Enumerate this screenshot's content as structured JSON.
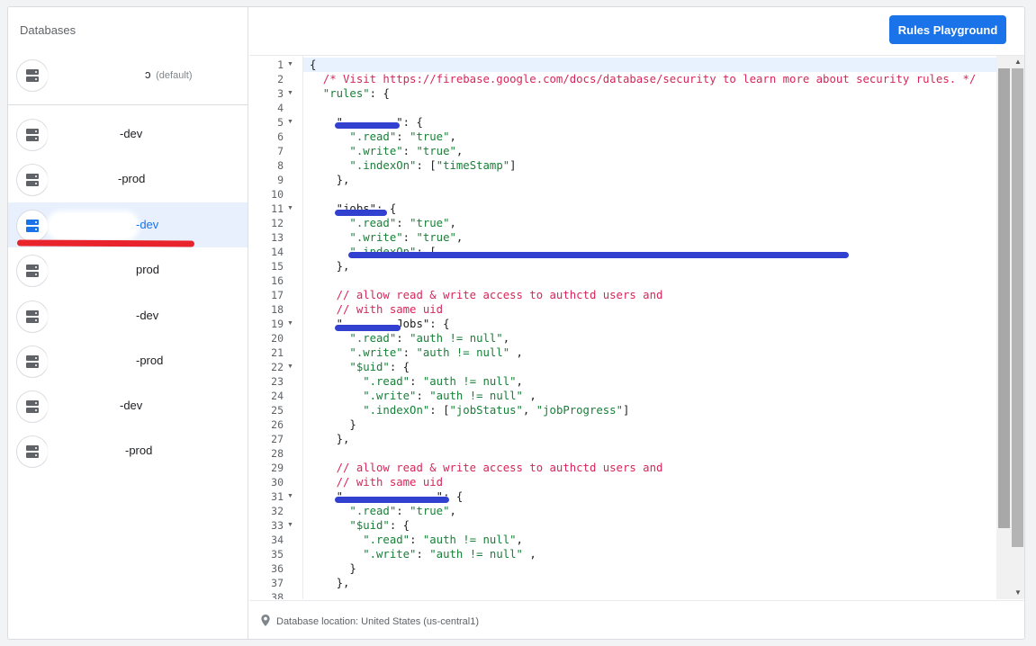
{
  "sidebar": {
    "title": "Databases",
    "items": [
      {
        "suffix": "",
        "tag": "(default)",
        "selected": false
      },
      {
        "suffix": "-dev",
        "selected": false
      },
      {
        "suffix": "-prod",
        "selected": false
      },
      {
        "suffix": "-dev",
        "selected": true
      },
      {
        "suffix": "prod",
        "selected": false
      },
      {
        "suffix": "-dev",
        "selected": false
      },
      {
        "suffix": "-prod",
        "selected": false
      },
      {
        "suffix": "-dev",
        "selected": false
      },
      {
        "suffix": "-prod",
        "selected": false
      }
    ],
    "icon": "database-icon",
    "selected_color": "#1a73e8"
  },
  "header": {
    "button_label": "Rules Playground",
    "button_color": "#1a73e8"
  },
  "editor": {
    "lines": [
      {
        "n": "1",
        "fold": true,
        "parts": [
          [
            "pu",
            "{"
          ]
        ]
      },
      {
        "n": "2",
        "parts": [
          [
            "cm",
            "  /* Visit https://firebase.google.com/docs/database/security to learn more about security rules. */"
          ]
        ]
      },
      {
        "n": "3",
        "fold": true,
        "parts": [
          [
            "st",
            "  \"rules\""
          ],
          [
            "pu",
            ": {"
          ]
        ]
      },
      {
        "n": "4",
        "parts": []
      },
      {
        "n": "5",
        "fold": true,
        "parts": [
          [
            "pu",
            "    \"        \": {"
          ]
        ]
      },
      {
        "n": "6",
        "parts": [
          [
            "st",
            "      \".read\""
          ],
          [
            "pu",
            ": "
          ],
          [
            "st",
            "\"true\""
          ],
          [
            "pu",
            ","
          ]
        ]
      },
      {
        "n": "7",
        "parts": [
          [
            "st",
            "      \".write\""
          ],
          [
            "pu",
            ": "
          ],
          [
            "st",
            "\"true\""
          ],
          [
            "pu",
            ","
          ]
        ]
      },
      {
        "n": "8",
        "parts": [
          [
            "st",
            "      \".indexOn\""
          ],
          [
            "pu",
            ": ["
          ],
          [
            "st",
            "\"timeStamp\""
          ],
          [
            "pu",
            "]"
          ]
        ]
      },
      {
        "n": "9",
        "parts": [
          [
            "pu",
            "    },"
          ]
        ]
      },
      {
        "n": "10",
        "parts": []
      },
      {
        "n": "11",
        "fold": true,
        "parts": [
          [
            "pu",
            "    \"jobs\": {"
          ]
        ]
      },
      {
        "n": "12",
        "parts": [
          [
            "st",
            "      \".read\""
          ],
          [
            "pu",
            ": "
          ],
          [
            "st",
            "\"true\""
          ],
          [
            "pu",
            ","
          ]
        ]
      },
      {
        "n": "13",
        "parts": [
          [
            "st",
            "      \".write\""
          ],
          [
            "pu",
            ": "
          ],
          [
            "st",
            "\"true\""
          ],
          [
            "pu",
            ","
          ]
        ]
      },
      {
        "n": "14",
        "parts": [
          [
            "st",
            "      \".indexOn\""
          ],
          [
            "pu",
            ": ["
          ]
        ]
      },
      {
        "n": "15",
        "parts": [
          [
            "pu",
            "    },"
          ]
        ]
      },
      {
        "n": "16",
        "parts": []
      },
      {
        "n": "17",
        "parts": [
          [
            "cm",
            "    // allow read & write access to authctd users and"
          ]
        ]
      },
      {
        "n": "18",
        "parts": [
          [
            "cm",
            "    // with same uid"
          ]
        ]
      },
      {
        "n": "19",
        "fold": true,
        "parts": [
          [
            "pu",
            "    \"        Jobs\": {"
          ]
        ]
      },
      {
        "n": "20",
        "parts": [
          [
            "st",
            "      \".read\""
          ],
          [
            "pu",
            ": "
          ],
          [
            "st",
            "\"auth != null\""
          ],
          [
            "pu",
            ","
          ]
        ]
      },
      {
        "n": "21",
        "parts": [
          [
            "st",
            "      \".write\""
          ],
          [
            "pu",
            ": "
          ],
          [
            "st",
            "\"auth != null\""
          ],
          [
            "pu",
            " ,"
          ]
        ]
      },
      {
        "n": "22",
        "fold": true,
        "parts": [
          [
            "st",
            "      \"$uid\""
          ],
          [
            "pu",
            ": {"
          ]
        ]
      },
      {
        "n": "23",
        "parts": [
          [
            "st",
            "        \".read\""
          ],
          [
            "pu",
            ": "
          ],
          [
            "st",
            "\"auth != null\""
          ],
          [
            "pu",
            ","
          ]
        ]
      },
      {
        "n": "24",
        "parts": [
          [
            "st",
            "        \".write\""
          ],
          [
            "pu",
            ": "
          ],
          [
            "st",
            "\"auth != null\""
          ],
          [
            "pu",
            " ,"
          ]
        ]
      },
      {
        "n": "25",
        "parts": [
          [
            "st",
            "        \".indexOn\""
          ],
          [
            "pu",
            ": ["
          ],
          [
            "st",
            "\"jobStatus\""
          ],
          [
            "pu",
            ", "
          ],
          [
            "st",
            "\"jobProgress\""
          ],
          [
            "pu",
            "]"
          ]
        ]
      },
      {
        "n": "26",
        "parts": [
          [
            "pu",
            "      }"
          ]
        ]
      },
      {
        "n": "27",
        "parts": [
          [
            "pu",
            "    },"
          ]
        ]
      },
      {
        "n": "28",
        "parts": []
      },
      {
        "n": "29",
        "parts": [
          [
            "cm",
            "    // allow read & write access to authctd users and"
          ]
        ]
      },
      {
        "n": "30",
        "parts": [
          [
            "cm",
            "    // with same uid"
          ]
        ]
      },
      {
        "n": "31",
        "fold": true,
        "parts": [
          [
            "pu",
            "    \"              \": {"
          ]
        ]
      },
      {
        "n": "32",
        "parts": [
          [
            "st",
            "      \".read\""
          ],
          [
            "pu",
            ": "
          ],
          [
            "st",
            "\"true\""
          ],
          [
            "pu",
            ","
          ]
        ]
      },
      {
        "n": "33",
        "fold": true,
        "parts": [
          [
            "st",
            "      \"$uid\""
          ],
          [
            "pu",
            ": {"
          ]
        ]
      },
      {
        "n": "34",
        "parts": [
          [
            "st",
            "        \".read\""
          ],
          [
            "pu",
            ": "
          ],
          [
            "st",
            "\"auth != null\""
          ],
          [
            "pu",
            ","
          ]
        ]
      },
      {
        "n": "35",
        "parts": [
          [
            "st",
            "        \".write\""
          ],
          [
            "pu",
            ": "
          ],
          [
            "st",
            "\"auth != null\""
          ],
          [
            "pu",
            " ,"
          ]
        ]
      },
      {
        "n": "36",
        "parts": [
          [
            "pu",
            "      }"
          ]
        ]
      },
      {
        "n": "37",
        "parts": [
          [
            "pu",
            "    },"
          ]
        ]
      },
      {
        "n": "38",
        "parts": []
      }
    ],
    "comment_color": "#d6265a",
    "string_color": "#188038",
    "scribble_color": "#3240cf"
  },
  "footer": {
    "icon": "location-pin-icon",
    "text": "Database location: United States (us-central1)"
  },
  "annotation_color": "#e8232b"
}
